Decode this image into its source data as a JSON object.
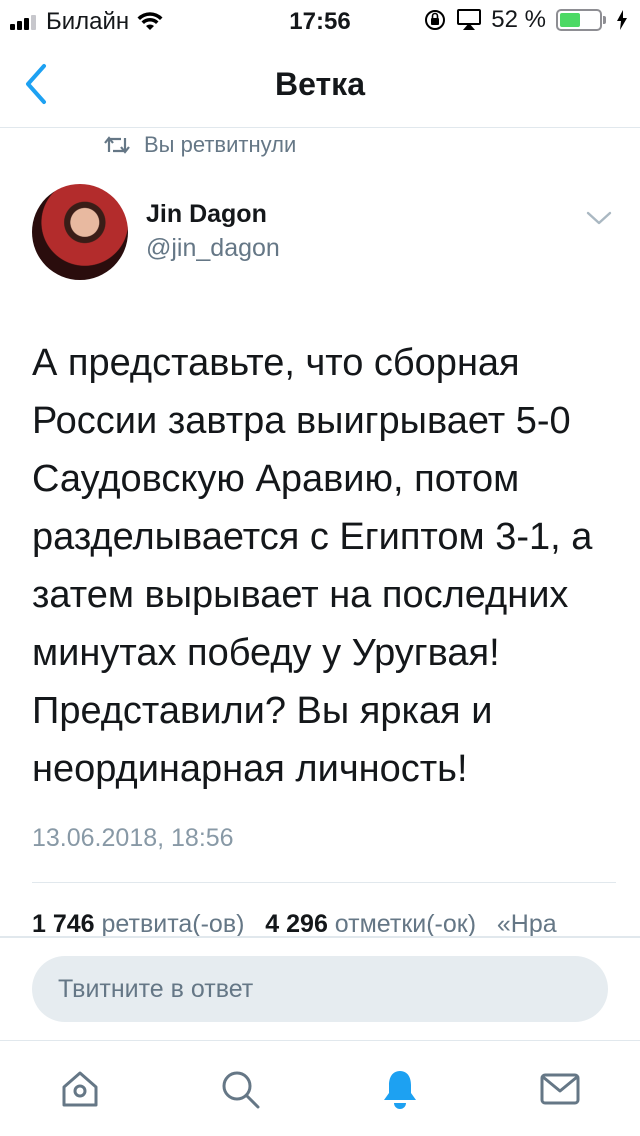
{
  "status_bar": {
    "carrier": "Билайн",
    "time": "17:56",
    "battery_percent": "52 %",
    "battery_level": 0.52
  },
  "nav": {
    "title": "Ветка",
    "back_icon": "chevron-left-icon"
  },
  "retweet_context": {
    "label": "Вы ретвитнули",
    "icon": "retweet-icon"
  },
  "tweet": {
    "author_name": "Jin Dagon",
    "author_handle": "@jin_dagon",
    "text": "А представьте, что сборная России завтра выигрывает 5-0 Саудовскую Аравию, потом разделывается с Египтом 3-1, а затем вырывает на последних минутах победу у Уругвая! Представили? Вы яркая и неординарная личность!",
    "date": "13.06.2018, 18:56"
  },
  "stats": {
    "retweets_count": "1 746",
    "retweets_label": "ретвита(-ов)",
    "likes_count": "4 296",
    "likes_label": "отметки(-ок)",
    "more_label": "«Нра"
  },
  "reply": {
    "placeholder": "Твитните в ответ"
  },
  "tab_bar": {
    "items": [
      {
        "icon": "home-icon"
      },
      {
        "icon": "search-icon"
      },
      {
        "icon": "notifications-bell-icon",
        "active": true
      },
      {
        "icon": "messages-envelope-icon"
      }
    ]
  },
  "colors": {
    "accent": "#1da1f2",
    "text": "#14171a",
    "muted": "#657786",
    "battery_green": "#4cd964"
  }
}
